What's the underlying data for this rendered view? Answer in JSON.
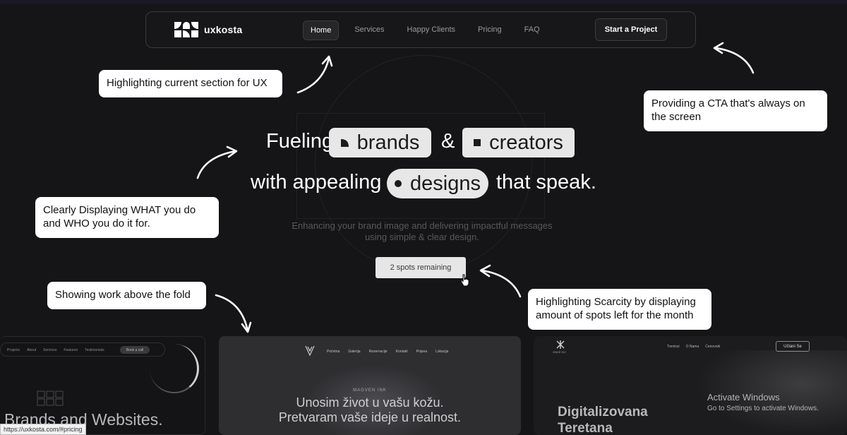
{
  "navbar": {
    "logo_text": "uxkosta",
    "items": [
      {
        "label": "Home",
        "active": true
      },
      {
        "label": "Services",
        "active": false
      },
      {
        "label": "Happy Clients",
        "active": false
      },
      {
        "label": "Pricing",
        "active": false
      },
      {
        "label": "FAQ",
        "active": false
      }
    ],
    "cta_label": "Start a Project"
  },
  "annotations": {
    "current_section": "Highlighting current section for UX",
    "cta_always": "Providing a CTA that's always on the screen",
    "what_who": "Clearly Displaying WHAT you do and WHO you do it for.",
    "work_above_fold": "Showing work above the fold",
    "scarcity": "Highlighting Scarcity by displaying amount of spots left for the month"
  },
  "hero": {
    "word_fueling": "Fueling",
    "pill_brands": "brands",
    "ampersand": "&",
    "pill_creators": "creators",
    "word_with": "with appealing",
    "pill_designs": "designs",
    "word_speak": "that speak.",
    "subtitle": "Enhancing your brand image and delivering impactful messages using simple & clear design.",
    "spots_label": "2 spots remaining"
  },
  "cards": {
    "card1": {
      "nav": [
        "Projects",
        "About",
        "Services",
        "Features",
        "Testimonials"
      ],
      "button": "Book a call",
      "title": "Brands and Websites."
    },
    "card2": {
      "nav": [
        "Početna",
        "Galerija",
        "Rezervacije",
        "Kontakt",
        "Prijava",
        "Lokacija"
      ],
      "eyebrow": "MAGVEN INK",
      "title_line1": "Unosim život u vašu kožu.",
      "title_line2": "Pretvaram vaše ideje u realnost."
    },
    "card3": {
      "brand": "ONCE DO",
      "nav": [
        "Treninzi",
        "O Nama",
        "Cenovnik"
      ],
      "button": "Učlani Se",
      "title_line1": "Digitalizovana",
      "title_line2": "Teretana"
    }
  },
  "windows_watermark": {
    "line1": "Activate Windows",
    "line2": "Go to Settings to activate Windows."
  },
  "status_url": "https://uxkosta.com/#pricing",
  "icons": {
    "brands_glyph": "quarter-circle-icon",
    "creators_glyph": "square-icon",
    "designs_glyph": "dot-icon",
    "cursor": "hand-pointer-icon"
  }
}
